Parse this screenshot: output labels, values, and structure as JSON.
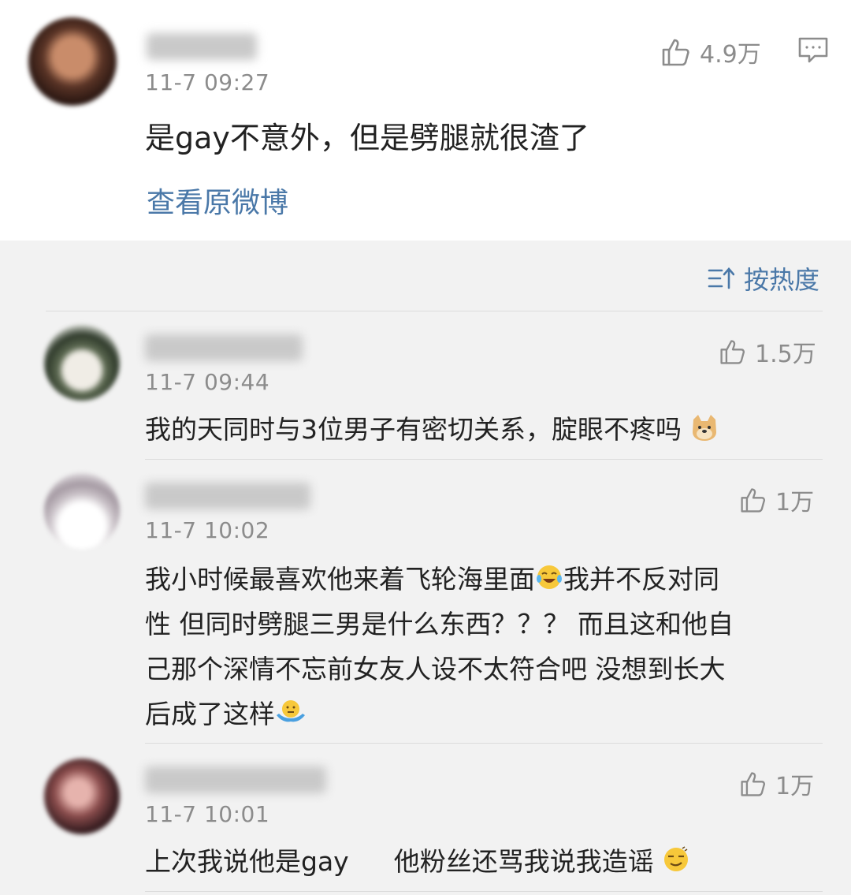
{
  "post": {
    "timestamp": "11-7 09:27",
    "like_count": "4.9万",
    "text": "是gay不意外，但是劈腿就很渣了",
    "view_original_label": "查看原微博"
  },
  "sort": {
    "label": "按热度"
  },
  "comments": [
    {
      "timestamp": "11-7 09:44",
      "like_count": "1.5万",
      "text": "我的天同时与3位男子有密切关系，腚眼不疼吗"
    },
    {
      "timestamp": "11-7 10:02",
      "like_count": "1万",
      "text_lines": [
        "我小时候最喜欢他来着飞轮海里面",
        "我并不反对同",
        "性 但同时劈腿三男是什么东西？？？ 而且这和他自",
        "己那个深情不忘前女友人设不太符合吧 没想到长大",
        "后成了这样"
      ]
    },
    {
      "timestamp": "11-7 10:01",
      "like_count": "1万",
      "text_a": "上次我说他是gay",
      "text_b": "他粉丝还骂我说我造谣"
    }
  ],
  "icons": [
    "thumbs-up-icon",
    "comment-icon",
    "sort-icon",
    "doge-emoji-icon",
    "laugh-cry-emoji-icon",
    "shrug-emoji-icon",
    "smug-emoji-icon"
  ],
  "colors": {
    "link": "#4a78a8",
    "secondary_text": "#8c8c8c",
    "background": "#f2f2f2"
  }
}
